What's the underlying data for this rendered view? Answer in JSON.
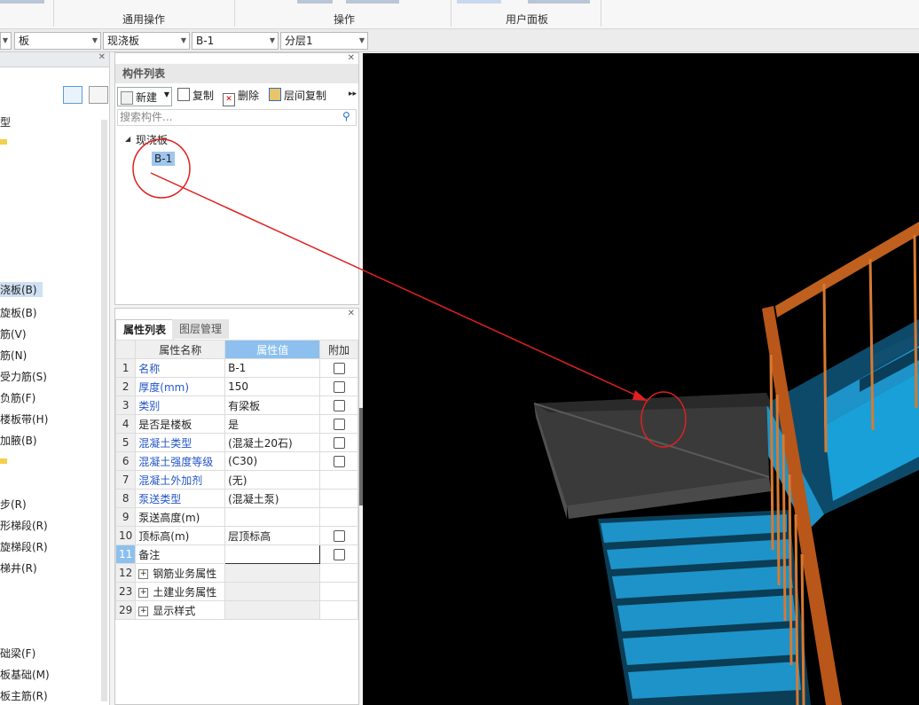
{
  "ribbon": {
    "groups": [
      "通用操作",
      "操作",
      "用户面板"
    ]
  },
  "selectors": [
    {
      "value": ""
    },
    {
      "value": "板"
    },
    {
      "value": "现浇板"
    },
    {
      "value": "B-1"
    },
    {
      "value": "分层1"
    }
  ],
  "left_tree": {
    "items": [
      "型",
      "浇板(B)",
      "旋板(B)",
      "筋(V)",
      "筋(N)",
      "受力筋(S)",
      "负筋(F)",
      "楼板带(H)",
      "加腋(B)",
      "步(R)",
      "形梯段(R)",
      "旋梯段(R)",
      "梯井(R)",
      "础梁(F)",
      "板基础(M)",
      "板主筋(R)"
    ]
  },
  "component_list": {
    "title": "构件列表",
    "toolbar": {
      "new": "新建",
      "copy": "复制",
      "delete": "删除",
      "floor_copy": "层间复制"
    },
    "search_placeholder": "搜索构件...",
    "tree": {
      "parent": "现浇板",
      "child": "B-1"
    }
  },
  "property_panel": {
    "tabs": [
      "属性列表",
      "图层管理"
    ],
    "columns": [
      "属性名称",
      "属性值",
      "附加"
    ],
    "rows": [
      {
        "num": "1",
        "name": "名称",
        "value": "B-1"
      },
      {
        "num": "2",
        "name": "厚度(mm)",
        "value": "150"
      },
      {
        "num": "3",
        "name": "类别",
        "value": "有梁板"
      },
      {
        "num": "4",
        "name": "是否是楼板",
        "value": "是"
      },
      {
        "num": "5",
        "name": "混凝土类型",
        "value": "(混凝土20石)"
      },
      {
        "num": "6",
        "name": "混凝土强度等级",
        "value": "(C30)"
      },
      {
        "num": "7",
        "name": "混凝土外加剂",
        "value": "(无)"
      },
      {
        "num": "8",
        "name": "泵送类型",
        "value": "(混凝土泵)"
      },
      {
        "num": "9",
        "name": "泵送高度(m)",
        "value": ""
      },
      {
        "num": "10",
        "name": "顶标高(m)",
        "value": "层顶标高"
      },
      {
        "num": "11",
        "name": "备注",
        "value": ""
      },
      {
        "num": "12",
        "name": "钢筋业务属性",
        "value": ""
      },
      {
        "num": "23",
        "name": "土建业务属性",
        "value": ""
      },
      {
        "num": "29",
        "name": "显示样式",
        "value": ""
      }
    ]
  }
}
